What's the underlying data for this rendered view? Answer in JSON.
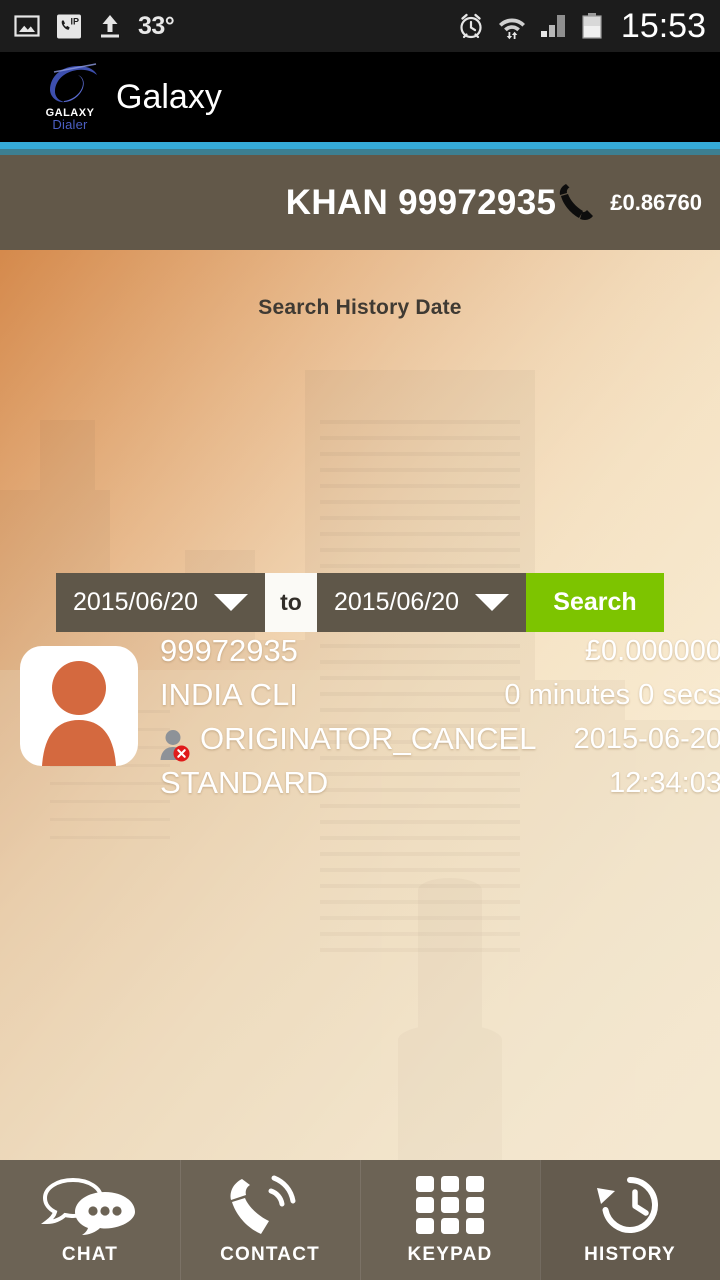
{
  "status_bar": {
    "left_icons": [
      "image-icon",
      "ip-call-icon",
      "upload-icon"
    ],
    "temperature": "33°",
    "right_icons": [
      "alarm-icon",
      "wifi-transfer-icon",
      "signal-icon",
      "battery-icon"
    ],
    "clock": "15:53"
  },
  "app_bar": {
    "logo_top_text": "GALAXY",
    "logo_bottom_text": "Dialer",
    "title": "Galaxy",
    "accent_bright": "#35abd8",
    "accent_dark": "#3c7f92"
  },
  "account": {
    "name": "KHAN 99972935",
    "phone_icon": "phone-handset-icon",
    "balance": "£0.86760",
    "bar_color": "#625849"
  },
  "search": {
    "title": "Search History Date",
    "from_date": "2015/06/20",
    "to_label": "to",
    "until_date": "2015/06/20",
    "button_label": "Search",
    "button_color": "#7dc400"
  },
  "history": {
    "entries": [
      {
        "number": "99972935",
        "route": "INDIA CLI",
        "status": "ORIGINATOR_CANCEL",
        "status_icon": "missed-call-contact-icon",
        "plan": "STANDARD",
        "cost": "£0.000000",
        "duration": "0 minutes 0 secs",
        "date": "2015-06-20",
        "time": "12:34:03",
        "avatar_icon": "person-avatar-icon"
      }
    ]
  },
  "bottom_nav": {
    "items": [
      {
        "label": "CHAT",
        "icon": "chat-bubbles-icon",
        "active": false
      },
      {
        "label": "CONTACT",
        "icon": "phone-ringing-icon",
        "active": false
      },
      {
        "label": "KEYPAD",
        "icon": "keypad-grid-icon",
        "active": false
      },
      {
        "label": "HISTORY",
        "icon": "history-clock-icon",
        "active": true
      }
    ]
  }
}
